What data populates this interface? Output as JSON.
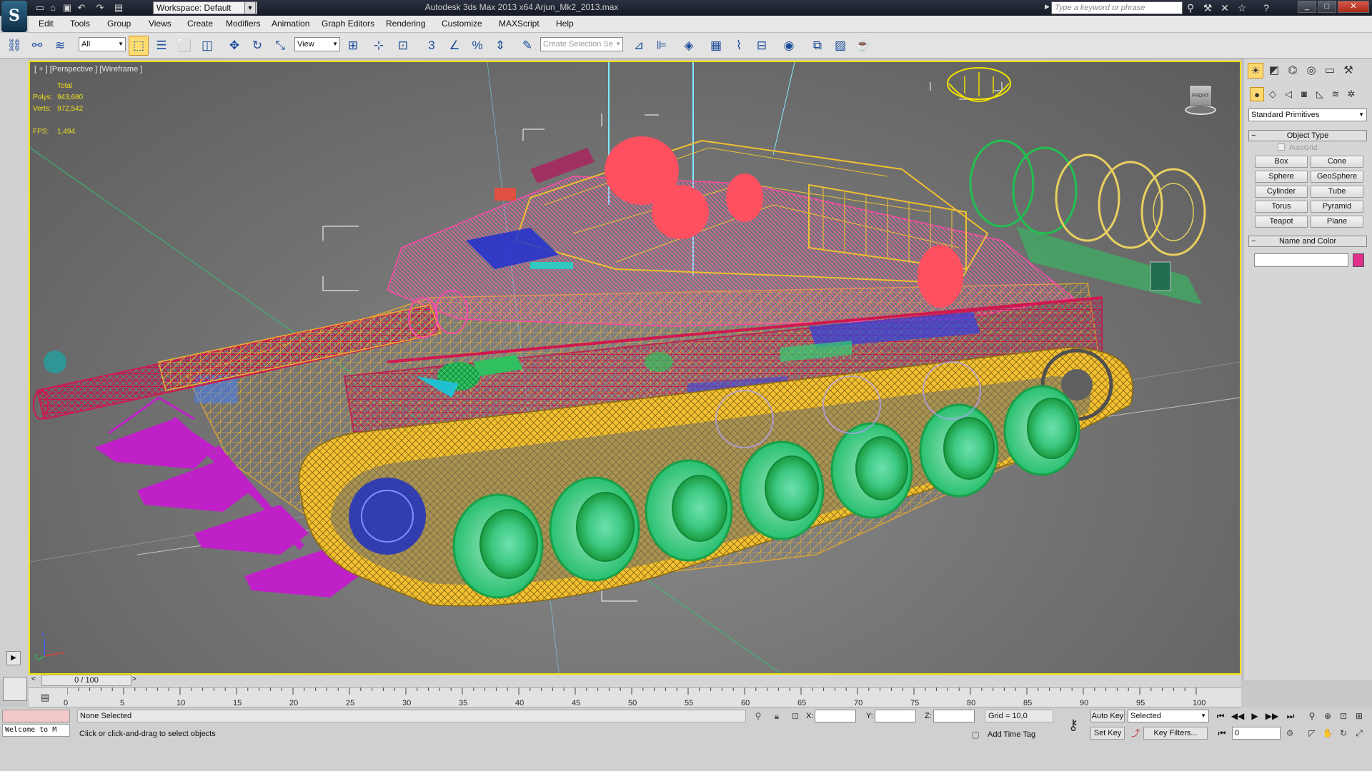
{
  "titlebar": {
    "app_title": "Autodesk 3ds Max  2013 x64      Arjun_Mk2_2013.max",
    "workspace": "Workspace: Default",
    "search_placeholder": "Type a keyword or phrase",
    "logo_glyph": "S"
  },
  "menu": [
    "Edit",
    "Tools",
    "Group",
    "Views",
    "Create",
    "Modifiers",
    "Animation",
    "Graph Editors",
    "Rendering",
    "Customize",
    "MAXScript",
    "Help"
  ],
  "toolbar": {
    "filter": "All",
    "ref_coord": "View",
    "selection_set_placeholder": "Create Selection Se"
  },
  "viewport": {
    "label": "[ + ] [Perspective ] [Wireframe ]",
    "stats": {
      "total_label": "Total",
      "polys_label": "Polys:",
      "polys": "943,680",
      "verts_label": "Verts:",
      "verts": "972,542",
      "fps_label": "FPS:",
      "fps": "1,494"
    },
    "viewcube_label": "FRONT",
    "axis": {
      "x": "x",
      "y": "y",
      "z": "z"
    }
  },
  "command_panel": {
    "category": "Standard Primitives",
    "object_type_title": "Object Type",
    "autogrid": "AutoGrid",
    "primitives": [
      "Box",
      "Cone",
      "Sphere",
      "GeoSphere",
      "Cylinder",
      "Tube",
      "Torus",
      "Pyramid",
      "Teapot",
      "Plane"
    ],
    "name_color_title": "Name and Color",
    "color": "#e0308a"
  },
  "timeline": {
    "slider_label": "0 / 100",
    "ticks": [
      "0",
      "5",
      "10",
      "15",
      "20",
      "25",
      "30",
      "35",
      "40",
      "45",
      "50",
      "55",
      "60",
      "65",
      "70",
      "75",
      "80",
      "85",
      "90",
      "95",
      "100"
    ]
  },
  "status": {
    "maxscript": "Welcome to M",
    "selection": "None Selected",
    "prompt": "Click or click-and-drag to select objects",
    "x_label": "X:",
    "y_label": "Y:",
    "z_label": "Z:",
    "grid": "Grid = 10,0",
    "add_time_tag": "Add Time Tag",
    "auto_key": "Auto Key",
    "set_key": "Set Key",
    "key_mode": "Selected",
    "key_filters": "Key Filters...",
    "frame": "0"
  },
  "colors": {
    "viewport_border": "#f0e000",
    "stats_text": "#f0e020",
    "active_tool": "#ffdc70"
  }
}
